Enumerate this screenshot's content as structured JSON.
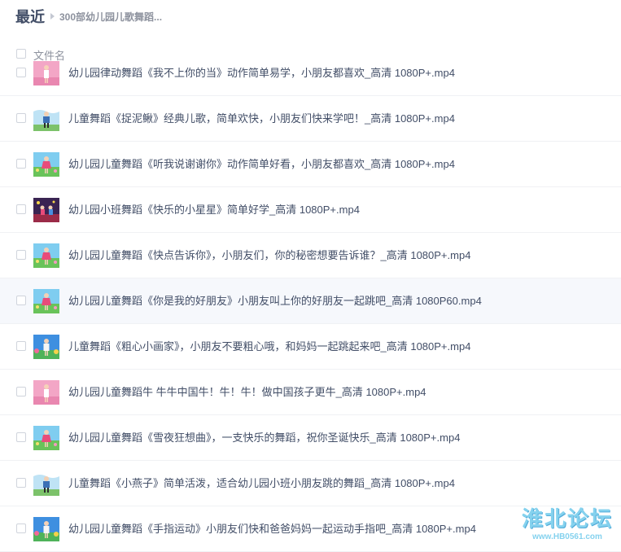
{
  "breadcrumb": {
    "root": "最近",
    "current": "300部幼儿园儿歌舞蹈..."
  },
  "header": {
    "column_label": "文件名"
  },
  "files": [
    {
      "name": "幼儿园律动舞蹈《我不上你的当》动作简单易学，小朋友都喜欢_高清 1080P+.mp4",
      "thumb": "pink-stage"
    },
    {
      "name": "儿童舞蹈《捉泥鳅》经典儿歌，简单欢快，小朋友们快来学吧！_高清 1080P+.mp4",
      "thumb": "sky-boy"
    },
    {
      "name": "幼儿园儿童舞蹈《听我说谢谢你》动作简单好看，小朋友都喜欢_高清 1080P+.mp4",
      "thumb": "grass-girl"
    },
    {
      "name": "幼儿园小班舞蹈《快乐的小星星》简单好学_高清 1080P+.mp4",
      "thumb": "dark-stage"
    },
    {
      "name": "幼儿园儿童舞蹈《快点告诉你》，小朋友们，你的秘密想要告诉谁？_高清 1080P+.mp4",
      "thumb": "grass-girl"
    },
    {
      "name": "幼儿园儿童舞蹈《你是我的好朋友》小朋友叫上你的好朋友一起跳吧_高清 1080P60.mp4",
      "thumb": "grass-girl"
    },
    {
      "name": "儿童舞蹈《粗心小画家》，小朋友不要粗心哦，和妈妈一起跳起来吧_高清 1080P+.mp4",
      "thumb": "flower-blue"
    },
    {
      "name": "幼儿园儿童舞蹈牛 牛牛中国牛！牛！牛！做中国孩子更牛_高清 1080P+.mp4",
      "thumb": "pink-stage"
    },
    {
      "name": "幼儿园儿童舞蹈《雪夜狂想曲》，一支快乐的舞蹈，祝你圣诞快乐_高清 1080P+.mp4",
      "thumb": "grass-girl"
    },
    {
      "name": "儿童舞蹈《小燕子》简单活泼，适合幼儿园小班小朋友跳的舞蹈_高清 1080P+.mp4",
      "thumb": "sky-boy"
    },
    {
      "name": "幼儿园儿童舞蹈《手指运动》小朋友们快和爸爸妈妈一起运动手指吧_高清 1080P+.mp4",
      "thumb": "flower-blue"
    }
  ],
  "watermark": {
    "title": "淮北论坛",
    "url": "www.HB0561.com"
  }
}
